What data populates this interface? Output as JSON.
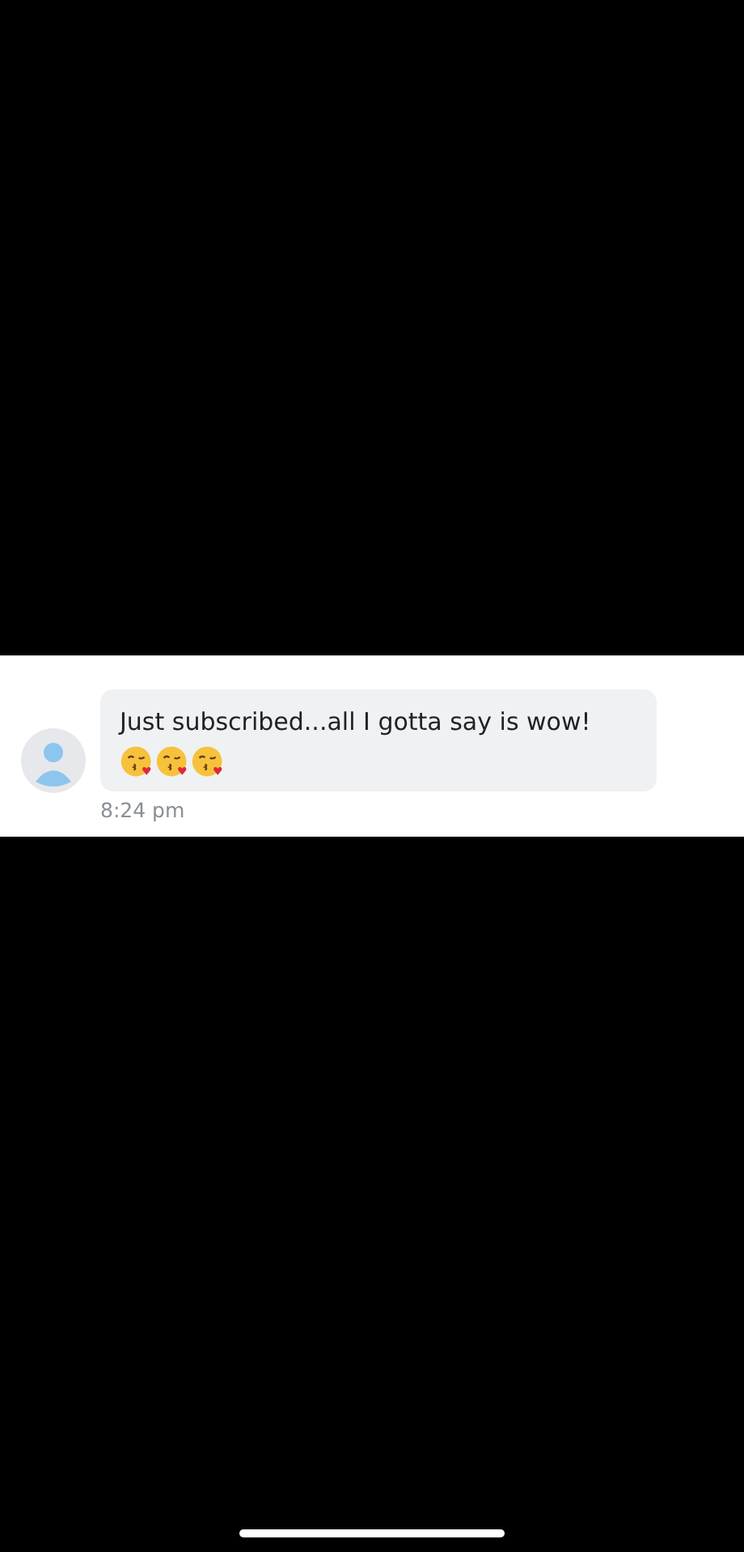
{
  "message": {
    "text": "Just subscribed...all I gotta say is wow!",
    "time": "8:24 pm"
  }
}
